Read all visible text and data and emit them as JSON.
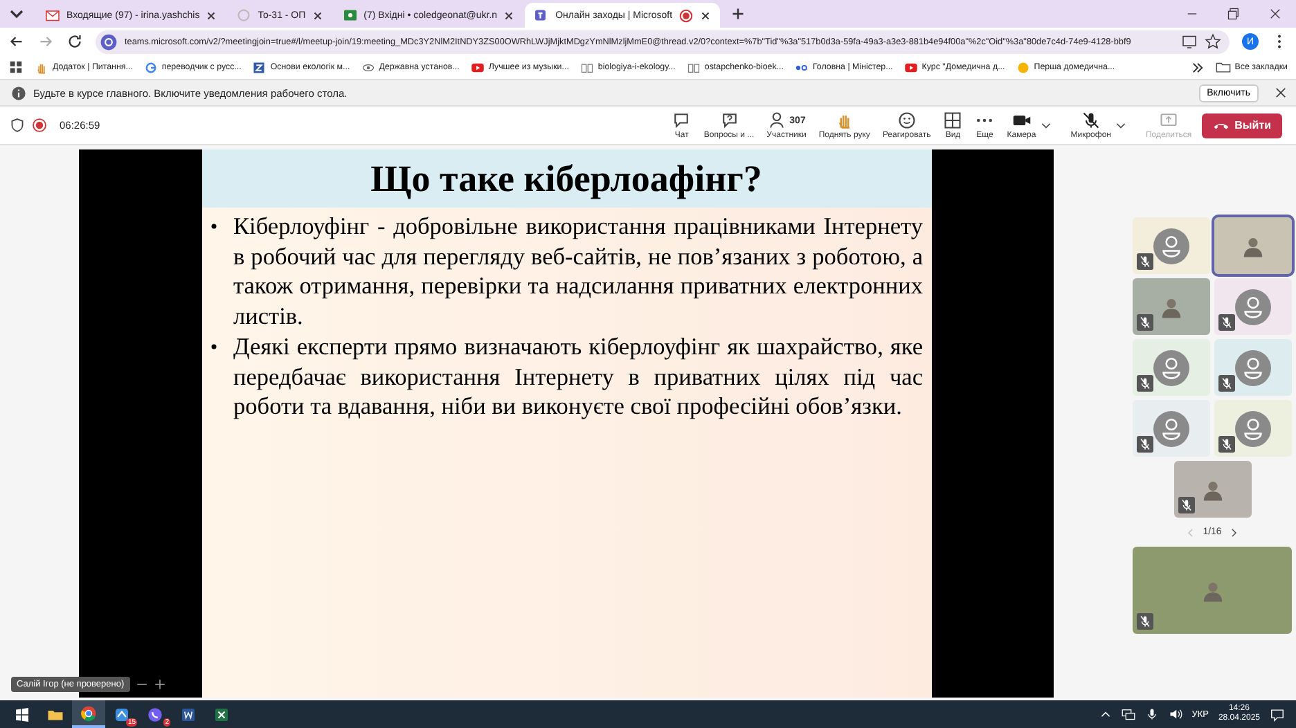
{
  "browser": {
    "tabs": [
      {
        "title": "Входящие (97) - irina.yashchis",
        "selected": false,
        "recording": false
      },
      {
        "title": "То-31 - ОП",
        "selected": false,
        "recording": false
      },
      {
        "title": "(7) Вхідні • coledgeonat@ukr.n",
        "selected": false,
        "recording": false
      },
      {
        "title": "Онлайн заходы | Microsoft",
        "selected": true,
        "recording": true
      }
    ],
    "url": "teams.microsoft.com/v2/?meetingjoin=true#/l/meetup-join/19:meeting_MDc3Y2NlM2ItNDY3ZS00OWRhLWJjMjktMDgzYmNlMzljMmE0@thread.v2/0?context=%7b\"Tid\"%3a\"517b0d3a-59fa-49a3-a3e3-881b4e94f00a\"%2c\"Oid\"%3a\"80de7c4d-74e9-4128-bbf9",
    "profile_initial": "И",
    "bookmarks": [
      "Додаток | Питання...",
      "переводчик с русс...",
      "Основи екологік м...",
      "Державна установ...",
      "Лучшее из музыки...",
      "biologiya-i-ekology...",
      "ostapchenko-bioek...",
      "Головна | Міністер...",
      "Курс \"Домедична д...",
      "Перша домедична..."
    ],
    "all_bookmarks": "Все закладки"
  },
  "notification": {
    "text": "Будьте в курсе главного. Включите уведомления рабочего стола.",
    "button": "Включить"
  },
  "meeting": {
    "recording": true,
    "timer": "06:26:59",
    "controls": [
      {
        "label": "Чат",
        "disabled": false
      },
      {
        "label": "Вопросы и ...",
        "disabled": false
      },
      {
        "label": "Участники",
        "count": "307",
        "disabled": false
      },
      {
        "label": "Поднять руку",
        "disabled": false
      },
      {
        "label": "Реагировать",
        "disabled": false
      },
      {
        "label": "Вид",
        "disabled": false
      },
      {
        "label": "Еще",
        "disabled": false
      },
      {
        "label": "Камера",
        "disabled": false,
        "dropdown": true
      },
      {
        "label": "Микрофон",
        "disabled": false,
        "dropdown": true
      },
      {
        "label": "Поделиться",
        "disabled": true
      }
    ],
    "leave_button": "Выйти"
  },
  "slide": {
    "title": "Що таке кіберлоафінг?",
    "bullets": [
      "Кіберлоуфінг - добровільне використання працівниками Інтернету в робочий час для перегляду веб-сайтів, не пов’язаних з роботою, а також отримання, перевірки та надсилання приватних електронних листів.",
      "Деякі експерти прямо визначають кіберлоуфінг як шахрайство, яке передбачає використання Інтернету в приватних цілях під час роботи та вдавання, ніби ви виконуєте свої професійні обов’язки."
    ],
    "presenter": "Салій Ігор (не проверено)"
  },
  "participants": {
    "tiles": [
      {
        "kind": "avatar",
        "muted": true,
        "speaking": false
      },
      {
        "kind": "video",
        "muted": false,
        "speaking": true
      },
      {
        "kind": "video",
        "muted": true,
        "speaking": false
      },
      {
        "kind": "avatar",
        "muted": true,
        "speaking": false
      },
      {
        "kind": "avatar",
        "muted": true,
        "speaking": false
      },
      {
        "kind": "avatar",
        "muted": true,
        "speaking": false
      },
      {
        "kind": "avatar",
        "muted": true,
        "speaking": false
      },
      {
        "kind": "avatar",
        "muted": true,
        "speaking": false
      }
    ],
    "single": {
      "kind": "video",
      "muted": true,
      "speaking": false
    },
    "page": "1/16",
    "self_view": {
      "kind": "video",
      "muted": true,
      "speaking": false
    }
  },
  "taskbar": {
    "apps": [
      {
        "active": false
      },
      {
        "active": false
      },
      {
        "active": true
      },
      {
        "active": false,
        "badge": "15"
      },
      {
        "active": false,
        "badge": "2"
      },
      {
        "active": false
      },
      {
        "active": false
      }
    ],
    "language": "УКР",
    "time": "14:26",
    "date": "28.04.2025"
  }
}
